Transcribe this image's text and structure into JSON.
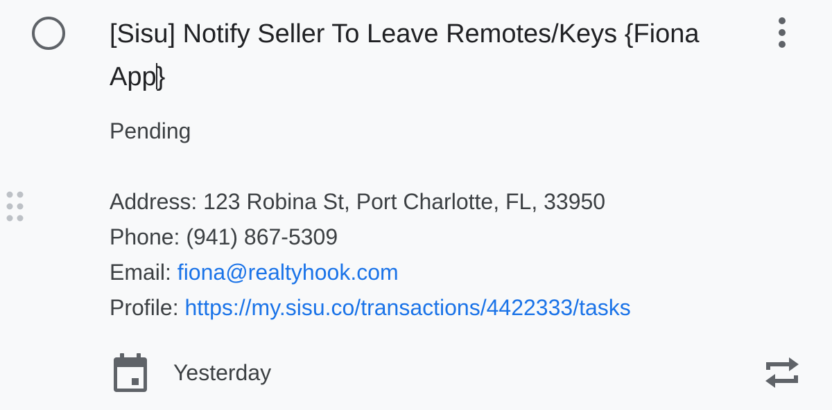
{
  "task": {
    "title_before_caret": "[Sisu] Notify Seller To Leave Remotes/Keys {Fiona App",
    "title_after_caret": "}",
    "status": "Pending",
    "details": {
      "address": "Address: 123 Robina St, Port Charlotte, FL, 33950",
      "phone": "Phone: (941) 867-5309",
      "email_label": "Email: ",
      "email": "fiona@realtyhook.com",
      "profile_label": "Profile: ",
      "profile_url": "https://my.sisu.co/transactions/4422333/tasks"
    },
    "due": "Yesterday"
  },
  "icons": {
    "complete": "circle-outline-icon",
    "more": "more-vert-icon",
    "drag": "drag-indicator-icon",
    "calendar": "calendar-event-icon",
    "repeat": "repeat-icon"
  },
  "colors": {
    "background": "#f8f9fa",
    "text": "#202124",
    "link": "#1a73e8",
    "icon": "#5f6368"
  }
}
